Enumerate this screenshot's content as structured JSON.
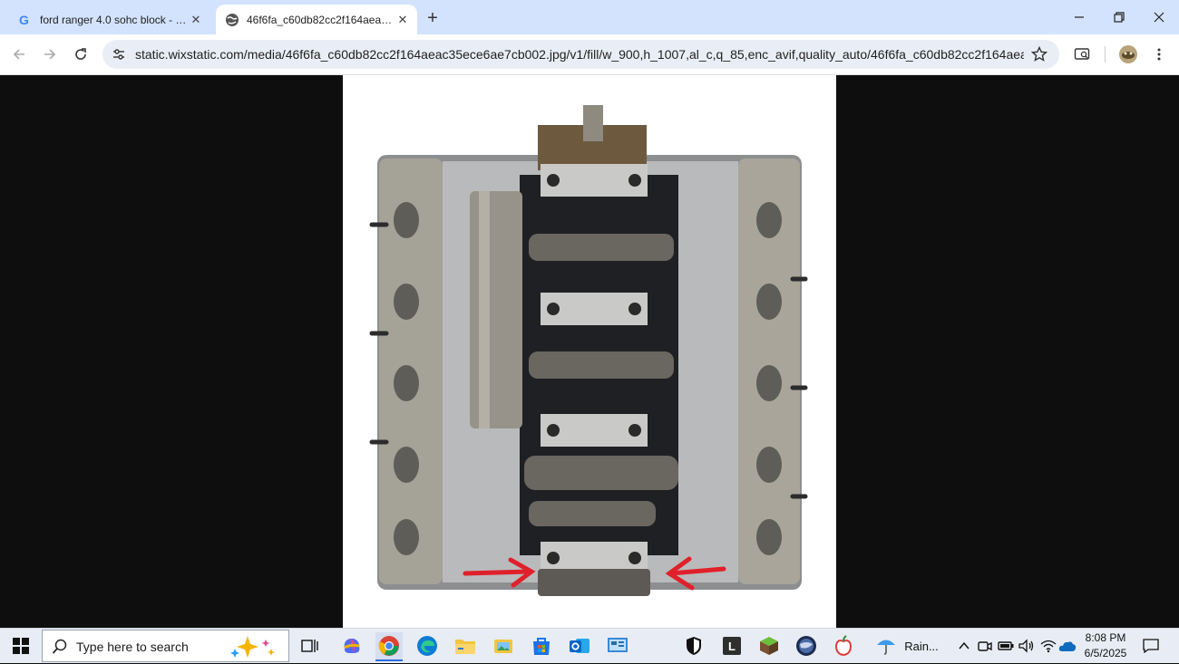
{
  "browser": {
    "tabs": [
      {
        "title": "ford ranger 4.0 sohc block - Google",
        "favicon": "google-g-icon",
        "active": false
      },
      {
        "title": "46f6fa_c60db82cc2f164aeac35ece6ae7cb002.jpg",
        "favicon": "globe-icon",
        "active": true
      }
    ],
    "url": "static.wixstatic.com/media/46f6fa_c60db82cc2f164aeac35ece6ae7cb002.jpg/v1/fill/w_900,h_1007,al_c,q_85,enc_avif,quality_auto/46f6fa_c60db82cc2f164aeac35ece6a...",
    "icons": [
      "back-icon",
      "forward-icon",
      "reload-icon",
      "site-settings-icon",
      "bookmark-star-icon",
      "tab-search-icon",
      "profile-avatar",
      "menu-icon"
    ],
    "accent": "#d3e3fd"
  },
  "content": {
    "image_description_colors": {
      "background": "#0e0e0e",
      "photo_bg": "#ffffff",
      "arrow": "#e0202a"
    }
  },
  "taskbar": {
    "search_placeholder": "Type here to search",
    "weather_label": "Rain...",
    "time": "8:08 PM",
    "date": "6/5/2025"
  }
}
